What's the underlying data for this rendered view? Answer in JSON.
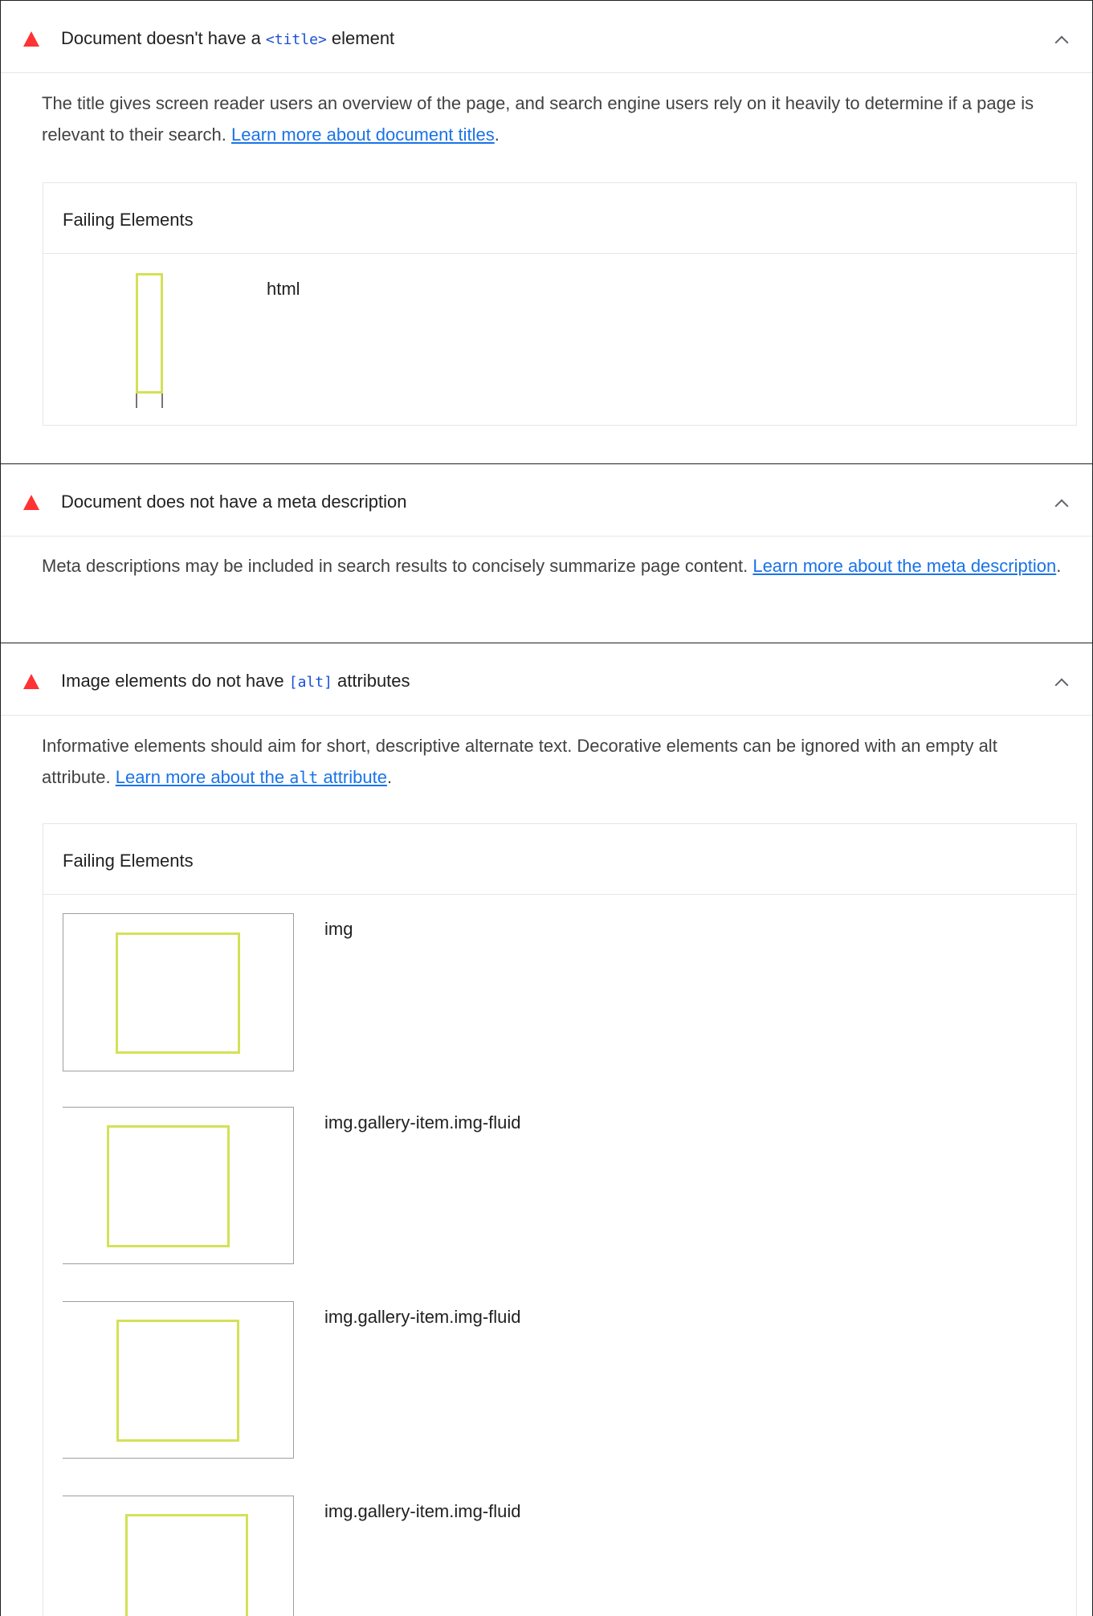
{
  "audits": [
    {
      "title_before": "Document doesn't have a ",
      "title_code": "<title>",
      "title_after": " element",
      "description": "The title gives screen reader users an overview of the page, and search engine users rely on it heavily to determine if a page is relevant to their search. ",
      "link_text": "Learn more about document titles",
      "description_end": ".",
      "table_header": "Failing Elements",
      "items": [
        {
          "selector": "html"
        }
      ]
    },
    {
      "title": "Document does not have a meta description",
      "description": "Meta descriptions may be included in search results to concisely summarize page content. ",
      "link_text": "Learn more about the meta description",
      "description_end": "."
    },
    {
      "title_before": "Image elements do not have ",
      "title_code": "[alt]",
      "title_after": " attributes",
      "description": "Informative elements should aim for short, descriptive alternate text. Decorative elements can be ignored with an empty alt attribute. ",
      "link_before": "Learn more about the ",
      "link_code": "alt",
      "link_after": " attribute",
      "description_end": ".",
      "table_header": "Failing Elements",
      "items": [
        {
          "selector": "img"
        },
        {
          "selector": "img.gallery-item.img-fluid"
        },
        {
          "selector": "img.gallery-item.img-fluid"
        },
        {
          "selector": "img.gallery-item.img-fluid"
        }
      ]
    }
  ],
  "colors": {
    "fail": "#ff3333",
    "link": "#1a73e8",
    "code": "#1a4fd6",
    "highlight": "#d4e157"
  },
  "icons": {
    "fail": "red-triangle-warning-icon",
    "collapse": "chevron-up-icon"
  }
}
